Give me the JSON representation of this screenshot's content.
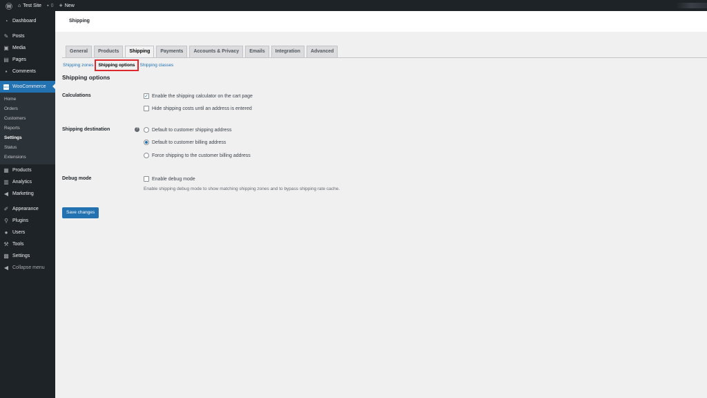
{
  "topbar": {
    "site": "Test Site",
    "comments": "0",
    "new": "New"
  },
  "sidebar": {
    "items": [
      "Dashboard",
      "Posts",
      "Media",
      "Pages",
      "Comments",
      "WooCommerce",
      "Products",
      "Analytics",
      "Marketing",
      "Appearance",
      "Plugins",
      "Users",
      "Tools",
      "Settings",
      "Collapse menu"
    ],
    "woo_sub": [
      "Home",
      "Orders",
      "Customers",
      "Reports",
      "Settings",
      "Status",
      "Extensions"
    ]
  },
  "header": {
    "title": "Shipping"
  },
  "tabs": [
    "General",
    "Products",
    "Shipping",
    "Payments",
    "Accounts & Privacy",
    "Emails",
    "Integration",
    "Advanced"
  ],
  "subnav": {
    "zones": "Shipping zones",
    "options": "Shipping options",
    "classes": "Shipping classes",
    "sep": "|"
  },
  "section_title": "Shipping options",
  "calc": {
    "label": "Calculations",
    "opt1": "Enable the shipping calculator on the cart page",
    "opt1_checked": true,
    "opt2": "Hide shipping costs until an address is entered",
    "opt2_checked": false
  },
  "dest": {
    "label": "Shipping destination",
    "help": "?",
    "opt1": "Default to customer shipping address",
    "opt2": "Default to customer billing address",
    "opt3": "Force shipping to the customer billing address",
    "selected": 2
  },
  "debug": {
    "label": "Debug mode",
    "opt": "Enable debug mode",
    "desc": "Enable shipping debug mode to show matching shipping zones and to bypass shipping rate cache."
  },
  "save": "Save changes"
}
